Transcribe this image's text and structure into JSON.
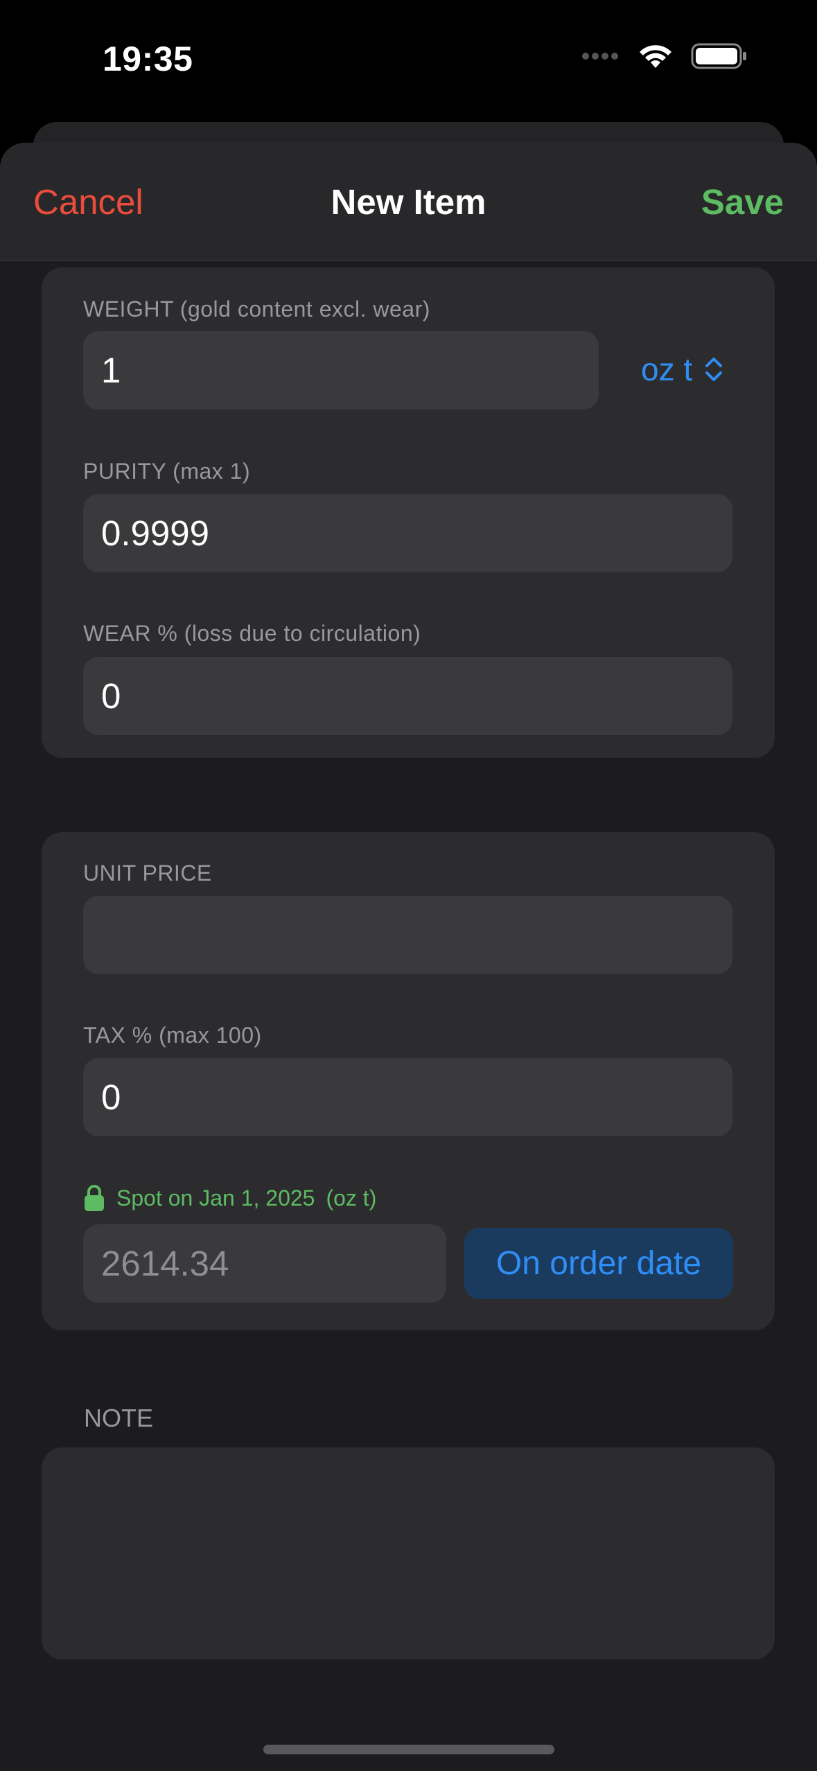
{
  "status": {
    "time": "19:35"
  },
  "nav": {
    "cancel": "Cancel",
    "title": "New Item",
    "save": "Save"
  },
  "weight": {
    "label": "WEIGHT (gold content excl. wear)",
    "value": "1",
    "unit": "oz t"
  },
  "purity": {
    "label": "PURITY (max 1)",
    "value": "0.9999"
  },
  "wear": {
    "label": "WEAR % (loss due to circulation)",
    "value": "0"
  },
  "unit_price": {
    "label": "UNIT PRICE",
    "value": ""
  },
  "tax": {
    "label": "TAX % (max 100)",
    "value": "0"
  },
  "spot": {
    "label": "Spot on Jan 1, 2025",
    "unit": "(oz t)",
    "value": "2614.34",
    "button": "On order date"
  },
  "note": {
    "label": "NOTE",
    "value": ""
  },
  "colors": {
    "accent": "#2f8ef5",
    "cancel": "#eb4d3d",
    "save": "#5dbb63"
  },
  "icons": [
    "signal-icon",
    "wifi-icon",
    "battery-icon",
    "chevron-updown-icon",
    "lock-icon"
  ]
}
